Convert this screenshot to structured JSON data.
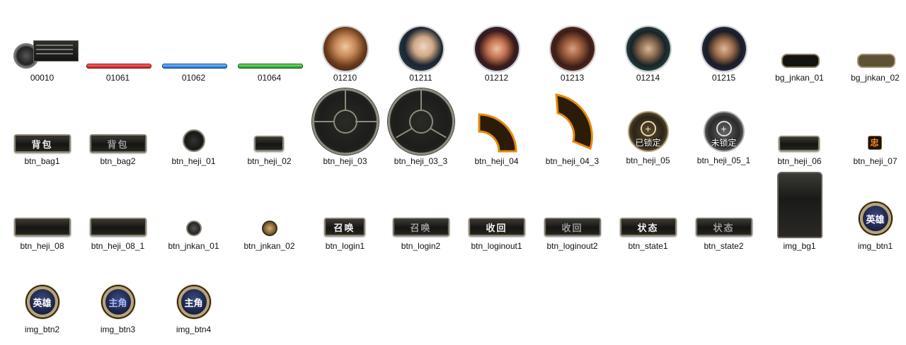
{
  "files": [
    {
      "name": "00010"
    },
    {
      "name": "01061"
    },
    {
      "name": "01062"
    },
    {
      "name": "01064"
    },
    {
      "name": "01210"
    },
    {
      "name": "01211"
    },
    {
      "name": "01212"
    },
    {
      "name": "01213"
    },
    {
      "name": "01214"
    },
    {
      "name": "01215"
    },
    {
      "name": "bg_jnkan_01"
    },
    {
      "name": "bg_jnkan_02"
    },
    {
      "name": "btn_bag1",
      "text": "背包"
    },
    {
      "name": "btn_bag2",
      "text": "背包"
    },
    {
      "name": "btn_heji_01"
    },
    {
      "name": "btn_heji_02"
    },
    {
      "name": "btn_heji_03"
    },
    {
      "name": "btn_heji_03_3"
    },
    {
      "name": "btn_heji_04"
    },
    {
      "name": "btn_heji_04_3"
    },
    {
      "name": "btn_heji_05",
      "text": "已锁定"
    },
    {
      "name": "btn_heji_05_1",
      "text": "未锁定"
    },
    {
      "name": "btn_heji_06"
    },
    {
      "name": "btn_heji_07",
      "text": "忠"
    },
    {
      "name": "btn_heji_08"
    },
    {
      "name": "btn_heji_08_1"
    },
    {
      "name": "btn_jnkan_01"
    },
    {
      "name": "btn_jnkan_02"
    },
    {
      "name": "btn_login1",
      "text": "召唤"
    },
    {
      "name": "btn_login2",
      "text": "召唤"
    },
    {
      "name": "btn_loginout1",
      "text": "收回"
    },
    {
      "name": "btn_loginout2",
      "text": "收回"
    },
    {
      "name": "btn_state1",
      "text": "状态"
    },
    {
      "name": "btn_state2",
      "text": "状态"
    },
    {
      "name": "img_bg1"
    },
    {
      "name": "img_btn1",
      "text": "英雄"
    },
    {
      "name": "img_btn2",
      "text": "英雄"
    },
    {
      "name": "img_btn3",
      "text": "主角"
    },
    {
      "name": "img_btn4",
      "text": "主角"
    }
  ],
  "colors": {
    "bar_red": "#d42a2a",
    "bar_blue": "#2f7ed8",
    "bar_green": "#2ea82e",
    "metal_border": "#8c8470",
    "gold": "#b8a47a",
    "orange": "#e8890c"
  }
}
